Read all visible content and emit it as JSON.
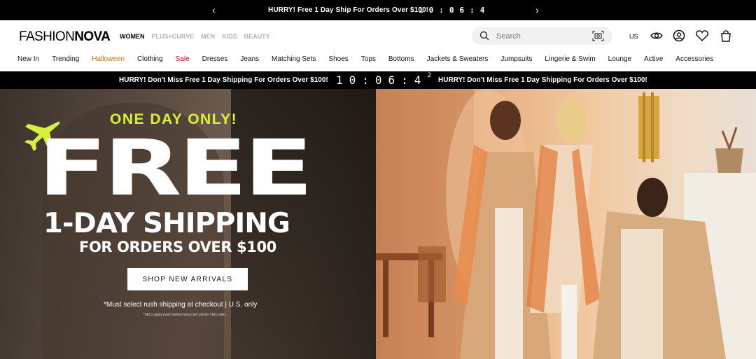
{
  "topbar": {
    "message": "HURRY! Free 1 Day Ship For Orders Over $100!",
    "timer": "10:06:4",
    "prev_icon": "chevron-left-icon",
    "next_icon": "chevron-right-icon"
  },
  "header": {
    "logo_part1": "FASHION",
    "logo_part2": "NOVA",
    "categories": [
      "WOMEN",
      "PLUS+CURVE",
      "MEN",
      "KIDS",
      "BEAUTY"
    ],
    "active_category": "WOMEN",
    "search_placeholder": "Search",
    "region": "US",
    "icons": [
      "search-icon",
      "camera-search-icon",
      "eye-icon",
      "account-icon",
      "heart-icon",
      "bag-icon"
    ]
  },
  "nav": {
    "items": [
      "New In",
      "Trending",
      "Halloween",
      "Clothing",
      "Sale",
      "Dresses",
      "Jeans",
      "Matching Sets",
      "Shoes",
      "Tops",
      "Bottoms",
      "Jackets & Sweaters",
      "Jumpsuits",
      "Lingerie & Swim",
      "Lounge",
      "Active",
      "Accessories"
    ]
  },
  "promo": {
    "left_message": "HURRY! Don't Miss Free 1 Day Shipping For Orders Over $100!",
    "timer": "10:06:4",
    "timer_sup": "2",
    "right_message": "HURRY! Don't Miss Free 1 Day Shipping For Orders Over $100!"
  },
  "hero": {
    "eyebrow": "ONE DAY ONLY!",
    "headline": "FREE",
    "subheadline": "1-DAY SHIPPING",
    "condition": "FOR ORDERS OVER $100",
    "cta": "SHOP NEW ARRIVALS",
    "fine_print": "*Must select rush shipping at checkout  |  U.S. only",
    "tiny_print": "*T&Cs apply (visit fashionnova.com promo T&Cs tab)",
    "accent_color": "#d7f23a"
  }
}
